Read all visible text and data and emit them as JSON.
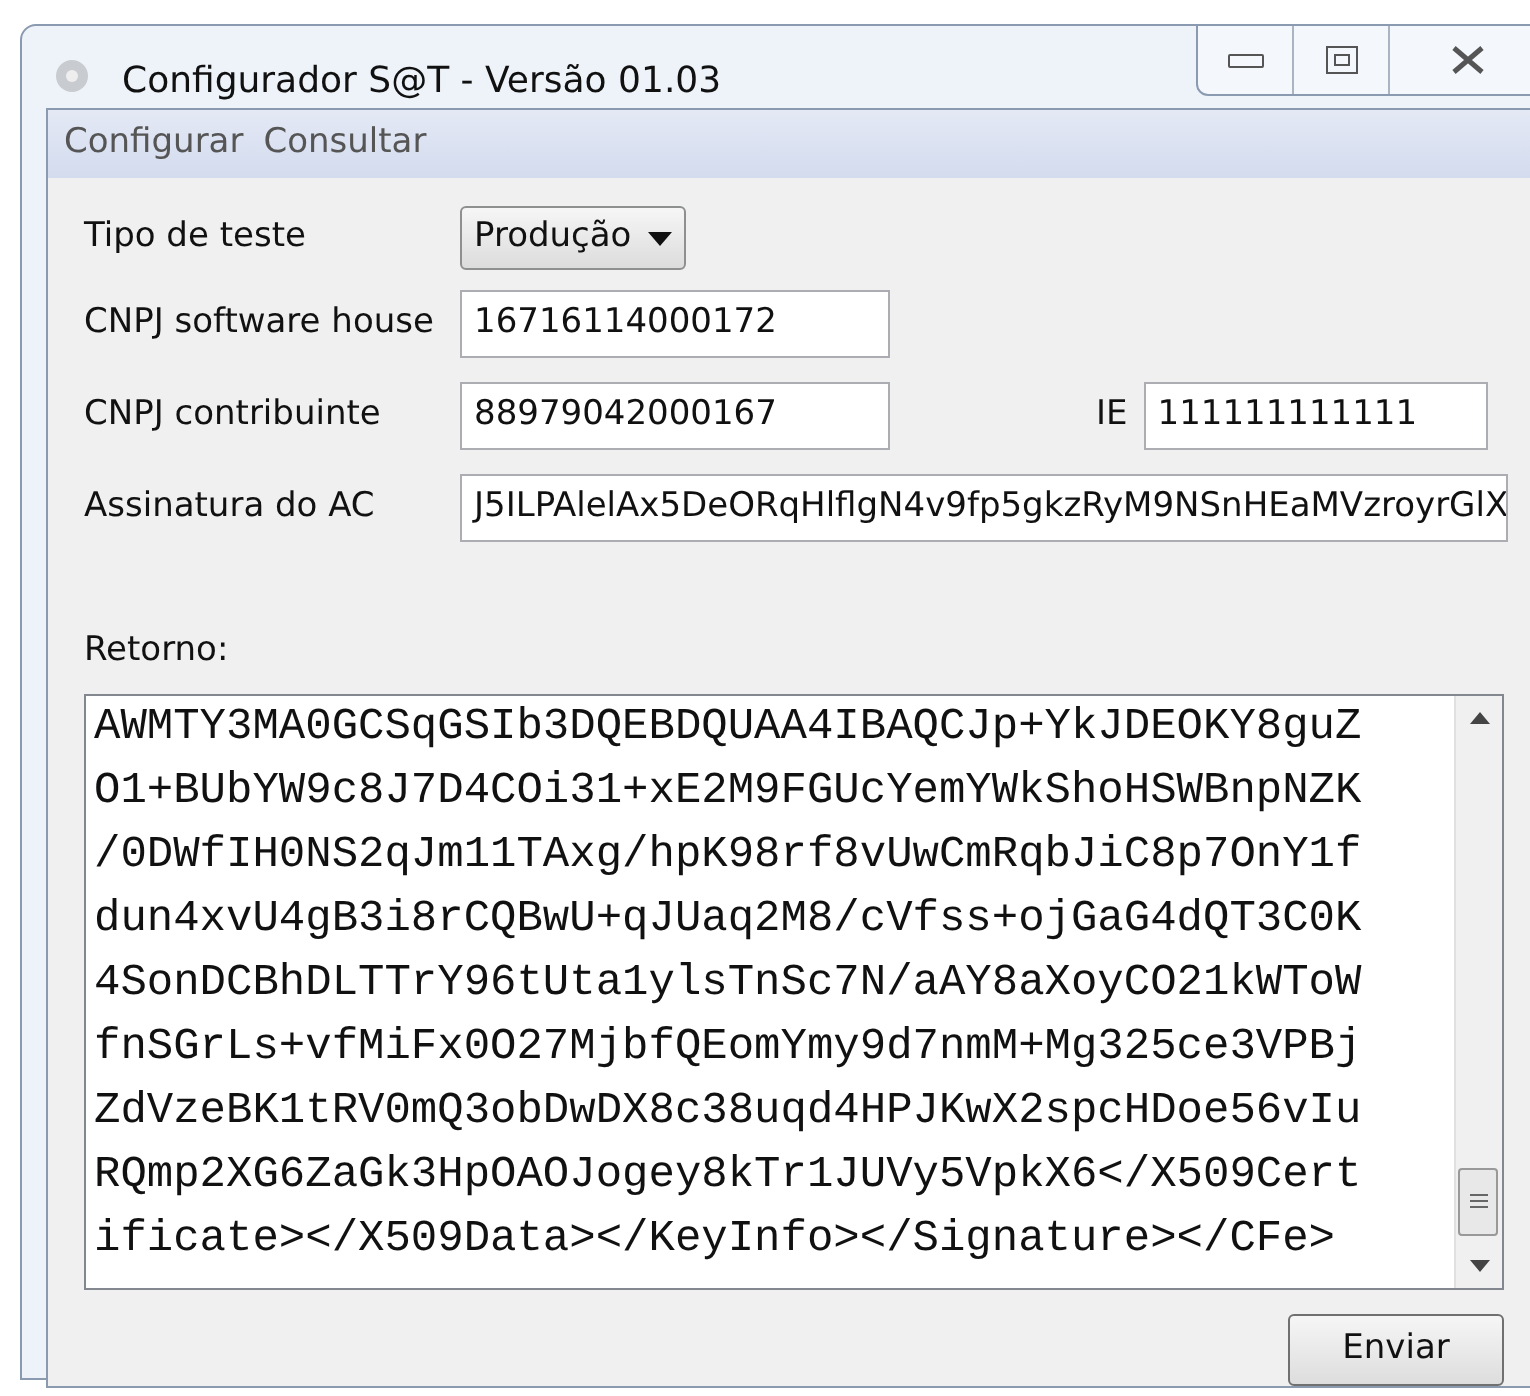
{
  "window": {
    "title": "Configurador S@T - Versão 01.03"
  },
  "menu": [
    "Configurar",
    "Consultar"
  ],
  "tipo_de_teste": {
    "label": "Tipo de teste",
    "value": "Produção"
  },
  "cnpj_software_house": {
    "label": "CNPJ software house",
    "value": "16716114000172"
  },
  "cnpj_contribuinte": {
    "label": "CNPJ contribuinte",
    "value": "88979042000167"
  },
  "ie": {
    "label": "IE",
    "value": "111111111111"
  },
  "assinatura_do_ac": {
    "label": "Assinatura do AC",
    "value": "J5ILPAlelAx5DeORqHlflgN4v9fp5gkzRyM9NSnHEaMVzroyrGlX"
  },
  "retorno": {
    "label": "Retorno:",
    "lines": [
      "AWMTY3MA0GCSqGSIb3DQEBDQUAA4IBAQCJp+YkJDEOKY8guZ",
      "O1+BUbYW9c8J7D4COi31+xE2M9FGUcYemYWkShoHSWBnpNZK",
      "/0DWfIH0NS2qJm11TAxg/hpK98rf8vUwCmRqbJiC8p7OnY1f",
      "dun4xvU4gB3i8rCQBwU+qJUaq2M8/cVfss+ojGaG4dQT3C0K",
      "4SonDCBhDLTTrY96tUta1ylsTnSc7N/aAY8aXoyCO21kWToW",
      "fnSGrLs+vfMiFx0O27MjbfQEomYmy9d7nmM+Mg325ce3VPBj",
      "ZdVzeBK1tRV0mQ3obDwDX8c38uqd4HPJKwX2spcHDoe56vIu",
      "RQmp2XG6ZaGk3HpOAOJogey8kTr1JUVy5VpkX6</X509Cert",
      "ificate></X509Data></KeyInfo></Signature></CFe>"
    ]
  },
  "send_button": "Enviar"
}
